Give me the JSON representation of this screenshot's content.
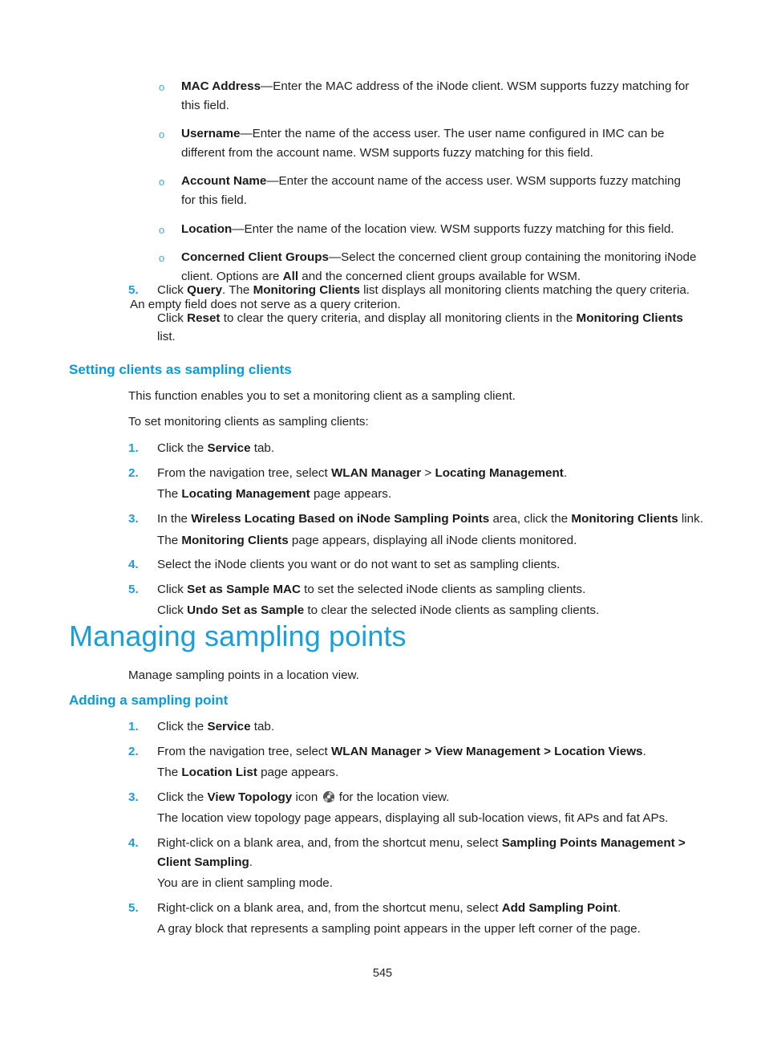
{
  "document": {
    "page_number": "545",
    "accent_heading_color": "#1b9fd8",
    "accent_subheading_color": "#0c9ad7",
    "bullet_marker_color": "#3aa9d8",
    "step_number_color": "#1b9dd9",
    "body_text_color": "#231f20"
  },
  "query_fields": {
    "items": [
      {
        "marker": "o",
        "term": "MAC Address",
        "dash": "—",
        "text": "Enter the MAC address of the iNode client. WSM supports fuzzy matching for this field."
      },
      {
        "marker": "o",
        "term": "Username",
        "dash": "—",
        "text": "Enter the name of the access user. The user name configured in IMC can be different from the account name. WSM supports fuzzy matching for this field."
      },
      {
        "marker": "o",
        "term": "Account Name",
        "dash": "—",
        "text": "Enter the account name of the access user. WSM supports fuzzy matching for this field."
      },
      {
        "marker": "o",
        "term": "Location",
        "dash": "—",
        "text": "Enter the name of the location view. WSM supports fuzzy matching for this field."
      },
      {
        "marker": "o",
        "term": "Concerned Client Groups",
        "dash": "—",
        "text_part1": "Select the concerned client group containing the monitoring iNode client. Options are ",
        "bold_mid": "All",
        "text_part2": " and the concerned client groups available for WSM."
      }
    ],
    "empty_field_note": "An empty field does not serve as a query criterion."
  },
  "step5_query": {
    "number": "5.",
    "line1_pre": "Click ",
    "line1_b1": "Query",
    "line1_mid": ". The ",
    "line1_b2": "Monitoring Clients",
    "line1_post": " list displays all monitoring clients matching the query criteria.",
    "line2_pre": "Click ",
    "line2_b1": "Reset",
    "line2_mid": " to clear the query criteria, and display all monitoring clients in the ",
    "line2_b2": "Monitoring Clients",
    "line2_post": " list."
  },
  "setting_clients_section": {
    "heading": "Setting clients as sampling clients",
    "intro1": "This function enables you to set a monitoring client as a sampling client.",
    "intro2": "To set monitoring clients as sampling clients:",
    "steps": [
      {
        "number": "1.",
        "pre": "Click the ",
        "b1": "Service",
        "post": " tab."
      },
      {
        "number": "2.",
        "pre": "From the navigation tree, select ",
        "b1": "WLAN Manager",
        "mid": " > ",
        "b2": "Locating Management",
        "post": ".",
        "continuation_pre": "The ",
        "continuation_b": "Locating Management",
        "continuation_post": " page appears."
      },
      {
        "number": "3.",
        "pre": "In the ",
        "b1": "Wireless Locating Based on iNode Sampling Points",
        "mid": " area, click the ",
        "b2": "Monitoring Clients",
        "post": " link.",
        "continuation_pre": "The ",
        "continuation_b": "Monitoring Clients",
        "continuation_post": " page appears, displaying all iNode clients monitored."
      },
      {
        "number": "4.",
        "pre": "Select the iNode clients you want or do not want to set as sampling clients."
      },
      {
        "number": "5.",
        "pre": "Click ",
        "b1": "Set as Sample MAC",
        "post": " to set the selected iNode clients as sampling clients.",
        "continuation_pre": "Click ",
        "continuation_b": "Undo Set as Sample",
        "continuation_post": " to clear the selected iNode clients as sampling clients."
      }
    ]
  },
  "managing_sampling_points": {
    "heading": "Managing sampling points",
    "intro": "Manage sampling points in a location view.",
    "subheading": "Adding a sampling point",
    "steps": [
      {
        "number": "1.",
        "pre": "Click the ",
        "b1": "Service",
        "post": " tab."
      },
      {
        "number": "2.",
        "pre": "From the navigation tree, select ",
        "b1": "WLAN Manager > View Management > Location Views",
        "post": ".",
        "continuation_pre": "The ",
        "continuation_b": "Location List",
        "continuation_post": " page appears."
      },
      {
        "number": "3.",
        "pre": "Click the ",
        "b1": "View Topology",
        "mid": " icon ",
        "icon": "view-topology-icon",
        "post": " for the location view.",
        "continuation_plain": "The location view topology page appears, displaying all sub-location views, fit APs and fat APs."
      },
      {
        "number": "4.",
        "pre": "Right-click on a blank area, and, from the shortcut menu, select ",
        "b1": "Sampling Points Management > Client Sampling",
        "post": ".",
        "continuation_plain": "You are in client sampling mode."
      },
      {
        "number": "5.",
        "pre": "Right-click on a blank area, and, from the shortcut menu, select ",
        "b1": "Add Sampling Point",
        "post": ".",
        "continuation_plain": "A gray block that represents a sampling point appears in the upper left corner of the page."
      }
    ]
  }
}
